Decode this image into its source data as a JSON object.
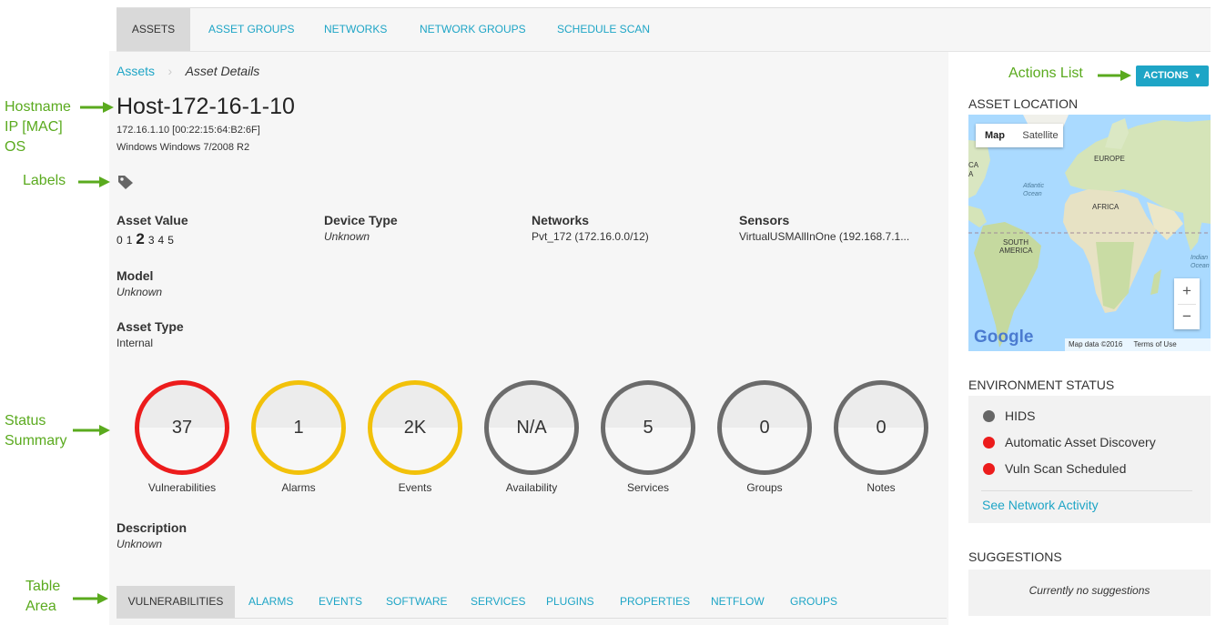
{
  "topnav": {
    "tabs": [
      {
        "label": "ASSETS",
        "active": true
      },
      {
        "label": "ASSET GROUPS"
      },
      {
        "label": "NETWORKS"
      },
      {
        "label": "NETWORK GROUPS"
      },
      {
        "label": "SCHEDULE SCAN"
      }
    ]
  },
  "breadcrumb": {
    "parent": "Assets",
    "current": "Asset Details"
  },
  "asset": {
    "hostname": "Host-172-16-1-10",
    "ip_mac": "172.16.1.10 [00:22:15:64:B2:6F]",
    "os": "Windows Windows 7/2008 R2"
  },
  "labels_icon": "tag-icon",
  "fields": {
    "asset_value": {
      "label": "Asset Value",
      "options": [
        "0",
        "1",
        "2",
        "3",
        "4",
        "5"
      ],
      "selected": "2"
    },
    "device_type": {
      "label": "Device Type",
      "value": "Unknown"
    },
    "networks": {
      "label": "Networks",
      "value": "Pvt_172 (172.16.0.0/12)"
    },
    "sensors": {
      "label": "Sensors",
      "value": "VirtualUSMAllInOne (192.168.7.1..."
    },
    "model": {
      "label": "Model",
      "value": "Unknown"
    },
    "asset_type": {
      "label": "Asset Type",
      "value": "Internal"
    },
    "description": {
      "label": "Description",
      "value": "Unknown"
    }
  },
  "status": [
    {
      "value": "37",
      "label": "Vulnerabilities",
      "color": "#ec1c1c"
    },
    {
      "value": "1",
      "label": "Alarms",
      "color": "#f2c10a"
    },
    {
      "value": "2K",
      "label": "Events",
      "color": "#f2c10a"
    },
    {
      "value": "N/A",
      "label": "Availability",
      "color": "#6b6b6b"
    },
    {
      "value": "5",
      "label": "Services",
      "color": "#6b6b6b"
    },
    {
      "value": "0",
      "label": "Groups",
      "color": "#6b6b6b"
    },
    {
      "value": "0",
      "label": "Notes",
      "color": "#6b6b6b"
    }
  ],
  "bottom_tabs": [
    {
      "label": "VULNERABILITIES",
      "active": true
    },
    {
      "label": "ALARMS"
    },
    {
      "label": "EVENTS"
    },
    {
      "label": "SOFTWARE"
    },
    {
      "label": "SERVICES"
    },
    {
      "label": "PLUGINS"
    },
    {
      "label": "PROPERTIES"
    },
    {
      "label": "NETFLOW"
    },
    {
      "label": "GROUPS"
    }
  ],
  "annotations": {
    "hostname": "Hostname",
    "ip_mac": "IP [MAC]",
    "os": "OS",
    "labels": "Labels",
    "status1": "Status",
    "status2": "Summary",
    "table1": "Table",
    "table2": "Area",
    "actions_list": "Actions List"
  },
  "sidebar": {
    "actions_button": "ACTIONS",
    "asset_location_title": "ASSET LOCATION",
    "map": {
      "map_btn": "Map",
      "satellite_btn": "Satellite",
      "labels": {
        "europe": "EUROPE",
        "africa": "AFRICA",
        "atlantic1": "Atlantic",
        "atlantic2": "Ocean",
        "south1": "SOUTH",
        "south2": "AMERICA",
        "indian1": "Indian",
        "indian2": "Ocean",
        "edge_ca": "CA",
        "edge_a": "A"
      },
      "zoom_in": "+",
      "zoom_out": "−",
      "google": "Google",
      "map_data": "Map data ©2016",
      "terms": "Terms of Use"
    },
    "environment_title": "ENVIRONMENT STATUS",
    "environment": [
      {
        "label": "HIDS",
        "color": "#666666"
      },
      {
        "label": "Automatic Asset Discovery",
        "color": "#ec1c1c"
      },
      {
        "label": "Vuln Scan Scheduled",
        "color": "#ec1c1c"
      }
    ],
    "network_link": "See Network Activity",
    "suggestions_title": "SUGGESTIONS",
    "suggestions_text": "Currently no suggestions"
  },
  "colors": {
    "accent": "#1ea5c6",
    "annotation": "#5aaa1e",
    "alert_red": "#ec1c1c",
    "warn_yellow": "#f2c10a"
  }
}
